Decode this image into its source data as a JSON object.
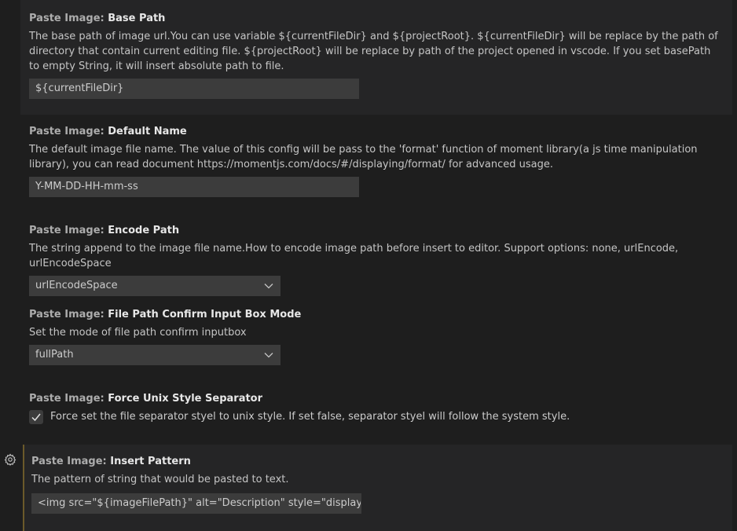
{
  "settings": [
    {
      "category": "Paste Image: ",
      "name": "Base Path",
      "description": "The base path of image url.You can use variable ${currentFileDir} and ${projectRoot}. ${currentFileDir} will be replace by the path of directory that contain current editing file. ${projectRoot} will be replace by path of the project opened in vscode. If you set basePath to empty String, it will insert absolute path to file.",
      "value": "${currentFileDir}"
    },
    {
      "category": "Paste Image: ",
      "name": "Default Name",
      "description": "The default image file name. The value of this config will be pass to the 'format' function of moment library(a js time manipulation library), you can read document https://momentjs.com/docs/#/displaying/format/ for advanced usage.",
      "value": "Y-MM-DD-HH-mm-ss"
    },
    {
      "category": "Paste Image: ",
      "name": "Encode Path",
      "description": "The string append to the image file name.How to encode image path before insert to editor. Support options: none, urlEncode, urlEncodeSpace",
      "value": "urlEncodeSpace"
    },
    {
      "category": "Paste Image: ",
      "name": "File Path Confirm Input Box Mode",
      "description": "Set the mode of file path confirm inputbox",
      "value": "fullPath"
    },
    {
      "category": "Paste Image: ",
      "name": "Force Unix Style Separator",
      "description": "Force set the file separator styel to unix style. If set false, separator styel will follow the system style.",
      "checked": true
    },
    {
      "category": "Paste Image: ",
      "name": "Insert Pattern",
      "description": "The pattern of string that would be pasted to text.",
      "value": "<img src=\"${imageFilePath}\" alt=\"Description\" style=\"display:block; ..."
    }
  ],
  "icons": {
    "gear": "gear-icon",
    "chevron": "chevron-down-icon",
    "check": "check-icon"
  },
  "colors": {
    "background": "#1e1e1e",
    "focused_row": "#252526",
    "focus_border": "#6b5a2a",
    "input_bg": "#3c3c3c"
  }
}
